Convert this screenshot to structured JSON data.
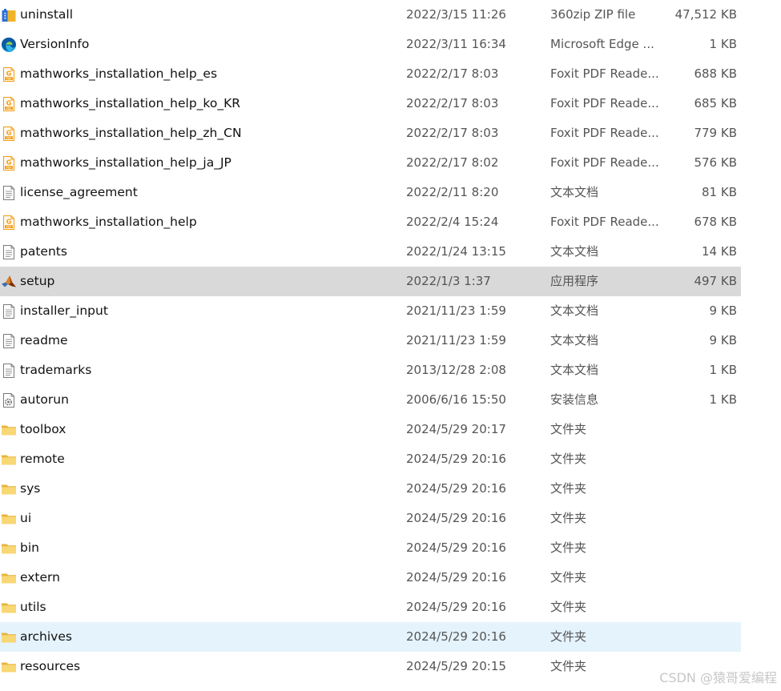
{
  "files": [
    {
      "name": "uninstall",
      "date": "2022/3/15 11:26",
      "type": "360zip ZIP file",
      "size": "47,512 KB",
      "icon": "zip-archive-icon"
    },
    {
      "name": "VersionInfo",
      "date": "2022/3/11 16:34",
      "type": "Microsoft Edge ...",
      "size": "1 KB",
      "icon": "edge-icon"
    },
    {
      "name": "mathworks_installation_help_es",
      "date": "2022/2/17 8:03",
      "type": "Foxit PDF Reade...",
      "size": "688 KB",
      "icon": "pdf-icon"
    },
    {
      "name": "mathworks_installation_help_ko_KR",
      "date": "2022/2/17 8:03",
      "type": "Foxit PDF Reade...",
      "size": "685 KB",
      "icon": "pdf-icon"
    },
    {
      "name": "mathworks_installation_help_zh_CN",
      "date": "2022/2/17 8:03",
      "type": "Foxit PDF Reade...",
      "size": "779 KB",
      "icon": "pdf-icon"
    },
    {
      "name": "mathworks_installation_help_ja_JP",
      "date": "2022/2/17 8:02",
      "type": "Foxit PDF Reade...",
      "size": "576 KB",
      "icon": "pdf-icon"
    },
    {
      "name": "license_agreement",
      "date": "2022/2/11 8:20",
      "type": "文本文档",
      "size": "81 KB",
      "icon": "text-file-icon"
    },
    {
      "name": "mathworks_installation_help",
      "date": "2022/2/4 15:24",
      "type": "Foxit PDF Reade...",
      "size": "678 KB",
      "icon": "pdf-icon"
    },
    {
      "name": "patents",
      "date": "2022/1/24 13:15",
      "type": "文本文档",
      "size": "14 KB",
      "icon": "text-file-icon"
    },
    {
      "name": "setup",
      "date": "2022/1/3 1:37",
      "type": "应用程序",
      "size": "497 KB",
      "icon": "matlab-icon",
      "state": "selected"
    },
    {
      "name": "installer_input",
      "date": "2021/11/23 1:59",
      "type": "文本文档",
      "size": "9 KB",
      "icon": "text-file-icon"
    },
    {
      "name": "readme",
      "date": "2021/11/23 1:59",
      "type": "文本文档",
      "size": "9 KB",
      "icon": "text-file-icon"
    },
    {
      "name": "trademarks",
      "date": "2013/12/28 2:08",
      "type": "文本文档",
      "size": "1 KB",
      "icon": "text-file-icon"
    },
    {
      "name": "autorun",
      "date": "2006/6/16 15:50",
      "type": "安装信息",
      "size": "1 KB",
      "icon": "setup-info-icon"
    },
    {
      "name": "toolbox",
      "date": "2024/5/29 20:17",
      "type": "文件夹",
      "size": "",
      "icon": "folder-icon"
    },
    {
      "name": "remote",
      "date": "2024/5/29 20:16",
      "type": "文件夹",
      "size": "",
      "icon": "folder-icon"
    },
    {
      "name": "sys",
      "date": "2024/5/29 20:16",
      "type": "文件夹",
      "size": "",
      "icon": "folder-icon"
    },
    {
      "name": "ui",
      "date": "2024/5/29 20:16",
      "type": "文件夹",
      "size": "",
      "icon": "folder-icon"
    },
    {
      "name": "bin",
      "date": "2024/5/29 20:16",
      "type": "文件夹",
      "size": "",
      "icon": "folder-icon"
    },
    {
      "name": "extern",
      "date": "2024/5/29 20:16",
      "type": "文件夹",
      "size": "",
      "icon": "folder-icon"
    },
    {
      "name": "utils",
      "date": "2024/5/29 20:16",
      "type": "文件夹",
      "size": "",
      "icon": "folder-icon"
    },
    {
      "name": "archives",
      "date": "2024/5/29 20:16",
      "type": "文件夹",
      "size": "",
      "icon": "folder-icon",
      "state": "hover"
    },
    {
      "name": "resources",
      "date": "2024/5/29 20:15",
      "type": "文件夹",
      "size": "",
      "icon": "folder-icon"
    }
  ],
  "watermark": "CSDN @猿哥爱编程",
  "colors": {
    "selected_row": "#d9d9d9",
    "hover_row": "#e5f3fd",
    "folder": "#f8d775",
    "pdf_accent": "#f39c12"
  }
}
